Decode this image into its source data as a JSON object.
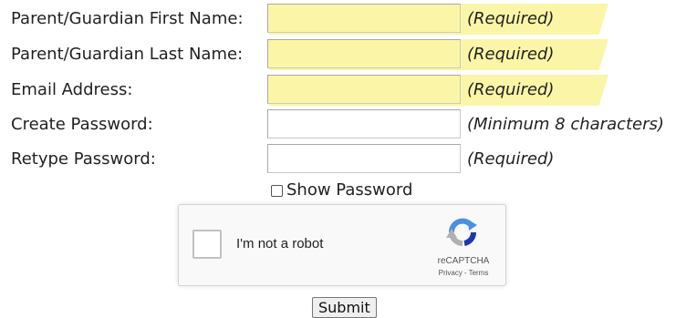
{
  "form": {
    "rows": [
      {
        "label": "Parent/Guardian First Name:",
        "hint": "(Required)",
        "value": ""
      },
      {
        "label": "Parent/Guardian Last Name:",
        "hint": "(Required)",
        "value": ""
      },
      {
        "label": "Email Address:",
        "hint": "(Required)",
        "value": ""
      },
      {
        "label": "Create Password:",
        "hint": "(Minimum 8 characters)",
        "value": ""
      },
      {
        "label": "Retype Password:",
        "hint": "(Required)",
        "value": ""
      }
    ],
    "show_password_label": "Show Password",
    "submit_label": "Submit"
  },
  "recaptcha": {
    "label": "I'm not a robot",
    "brand": "reCAPTCHA",
    "privacy": "Privacy",
    "separator": "-",
    "terms": "Terms"
  },
  "colors": {
    "required_highlight": "#fbf6a7",
    "recaptcha_blue": "#4a90e2",
    "recaptcha_dark_blue": "#1c3aa9",
    "recaptcha_gray": "#b1b1b1"
  }
}
